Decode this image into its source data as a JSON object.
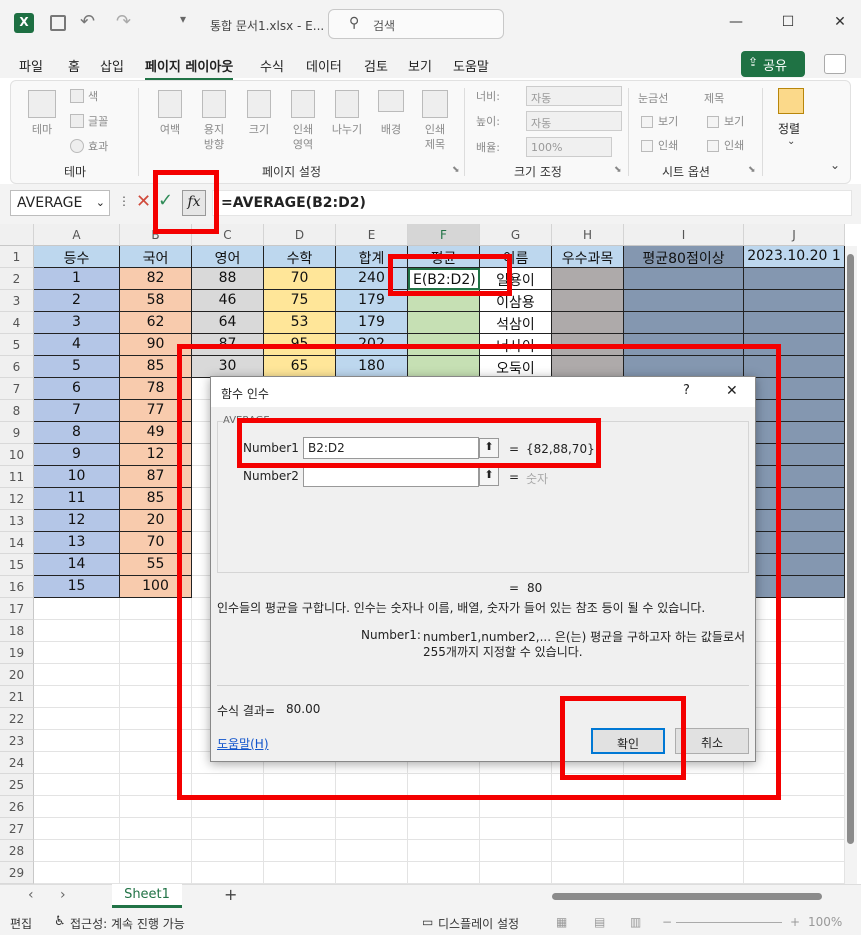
{
  "titlebar": {
    "title": "통합 문서1.xlsx  -  E...",
    "search_placeholder": "검색",
    "minimize_label": "—",
    "maximize_label": "☐",
    "close_label": "✕"
  },
  "menu": {
    "items": [
      "파일",
      "홈",
      "삽입",
      "페이지 레이아웃",
      "수식",
      "데이터",
      "검토",
      "보기",
      "도움말"
    ],
    "active": "페이지 레이아웃",
    "share_label": "공유"
  },
  "ribbon": {
    "theme": {
      "label": "테마",
      "colors": "색",
      "fonts": "글꼴",
      "effects": "효과",
      "group": "테마"
    },
    "page_setup": {
      "items": [
        "여백",
        "용지\n방향",
        "크기",
        "인쇄\n영역",
        "나누기",
        "배경",
        "인쇄\n제목"
      ],
      "group": "페이지 설정"
    },
    "scale": {
      "width_label": "너비:",
      "height_label": "높이:",
      "scale_label": "배율:",
      "width_value": "자동",
      "height_value": "자동",
      "scale_value": "100%",
      "group": "크기 조정"
    },
    "sheet_options": {
      "gridlines": "눈금선",
      "headings": "제목",
      "view": "보기",
      "print": "인쇄",
      "group": "시트 옵션"
    },
    "arrange": {
      "label": "정렬"
    }
  },
  "formula_bar": {
    "name_box": "AVERAGE",
    "fx_label": "fx",
    "formula": "=AVERAGE(B2:D2)"
  },
  "sheet": {
    "columns": [
      "A",
      "B",
      "C",
      "D",
      "E",
      "F",
      "G",
      "H",
      "I",
      "J"
    ],
    "rows": [
      "1",
      "2",
      "3",
      "4",
      "5",
      "6",
      "7",
      "8",
      "9",
      "10",
      "11",
      "12",
      "13",
      "14",
      "15",
      "16",
      "17",
      "18",
      "19",
      "20",
      "21",
      "22",
      "23",
      "24",
      "25",
      "26",
      "27",
      "28",
      "29"
    ],
    "headers": [
      "등수",
      "국어",
      "영어",
      "수학",
      "합계",
      "평균",
      "이름",
      "우수과목",
      "평균80점이상",
      "2023.10.20 1"
    ],
    "A": [
      "1",
      "2",
      "3",
      "4",
      "5",
      "6",
      "7",
      "8",
      "9",
      "10",
      "11",
      "12",
      "13",
      "14",
      "15"
    ],
    "B": [
      "82",
      "58",
      "62",
      "90",
      "85",
      "78",
      "77",
      "49",
      "12",
      "87",
      "85",
      "20",
      "70",
      "55",
      "100"
    ],
    "C": [
      "88",
      "46",
      "64",
      "87",
      "30"
    ],
    "D": [
      "70",
      "75",
      "53",
      "95",
      "65"
    ],
    "E": [
      "240",
      "179",
      "179",
      "202",
      "180"
    ],
    "F2": "E(B2:D2)",
    "G": [
      "일용이",
      "이삼용",
      "석삼이",
      "너사이",
      "오둑이"
    ]
  },
  "dialog": {
    "title": "함수 인수",
    "help_q": "?",
    "close": "✕",
    "function_name": "AVERAGE",
    "arg1_label": "Number1",
    "arg1_value": "B2:D2",
    "arg1_result": "{82,88,70}",
    "arg2_label": "Number2",
    "arg2_value": "",
    "arg2_result": "숫자",
    "equals": "=",
    "total_result": "80",
    "description": "인수들의 평균을 구합니다. 인수는 숫자나 이름, 배열, 숫자가 들어 있는 참조 등이 될 수 있습니다.",
    "arg_help_label": "Number1:",
    "arg_help_text1": "number1,number2,... 은(는) 평균을 구하고자 하는 값들로서",
    "arg_help_text2": "255개까지 지정할 수 있습니다.",
    "formula_result_label": "수식 결과=",
    "formula_result_value": "80.00",
    "help_link": "도움말(H)",
    "ok": "확인",
    "cancel": "취소"
  },
  "tabs": {
    "sheet1": "Sheet1",
    "add": "+"
  },
  "status": {
    "mode": "편집",
    "accessibility": "접근성: 계속 진행 가능",
    "display": "디스플레이 설정",
    "zoom": "100%"
  },
  "colors": {
    "blue_header": "#bdd7ee",
    "rank_blue": "#b4c6e7",
    "korean_orange": "#f8cbad",
    "english_gray": "#d9d9d9",
    "math_yellow": "#ffe699",
    "avg_green": "#c6e0b4",
    "brown_gray": "#aeaaaa",
    "navy_gray": "#8497b0",
    "red_highlight": "#f40000",
    "excel_green": "#217346"
  }
}
